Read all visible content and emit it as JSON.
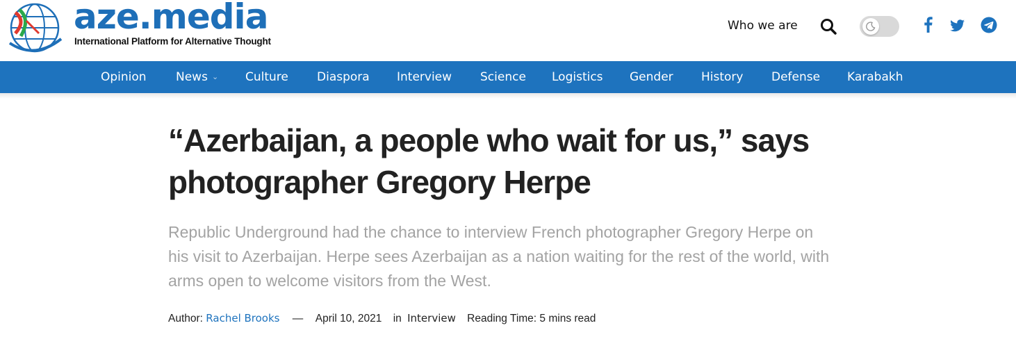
{
  "site": {
    "name": "aze.media",
    "tagline": "International Platform for Alternative Thought"
  },
  "header": {
    "who_we_are": "Who we are",
    "search_icon": "search-icon",
    "theme_toggle_icon": "moon-icon",
    "social": [
      {
        "icon": "facebook-icon"
      },
      {
        "icon": "twitter-icon"
      },
      {
        "icon": "telegram-icon"
      }
    ]
  },
  "nav": {
    "items": [
      {
        "label": "Opinion"
      },
      {
        "label": "News",
        "has_dropdown": true
      },
      {
        "label": "Culture"
      },
      {
        "label": "Diaspora"
      },
      {
        "label": "Interview"
      },
      {
        "label": "Science"
      },
      {
        "label": "Logistics"
      },
      {
        "label": "Gender"
      },
      {
        "label": "History"
      },
      {
        "label": "Defense"
      },
      {
        "label": "Karabakh"
      }
    ]
  },
  "article": {
    "title_line1": "“Azerbaijan, a people who wait for us,” says",
    "title_line2": "photographer Gregory Herpe",
    "dek": "Republic Underground had the chance to interview French photographer Gregory Herpe on his visit to Azerbaijan. Herpe sees Azerbaijan as a nation waiting for the rest of the world, with arms open to welcome visitors from the West.",
    "meta": {
      "author_label": "Author:",
      "author": "Rachel Brooks",
      "separator": "—",
      "date": "April 10, 2021",
      "in_label": "in",
      "category": "Interview",
      "reading_time": "Reading Time: 5 mins read"
    }
  },
  "colors": {
    "brand_blue": "#1e73be",
    "logo_blue": "#1e6fb8",
    "dek_gray": "#a3a3a3",
    "toggle_bg": "#d9d9d9"
  }
}
